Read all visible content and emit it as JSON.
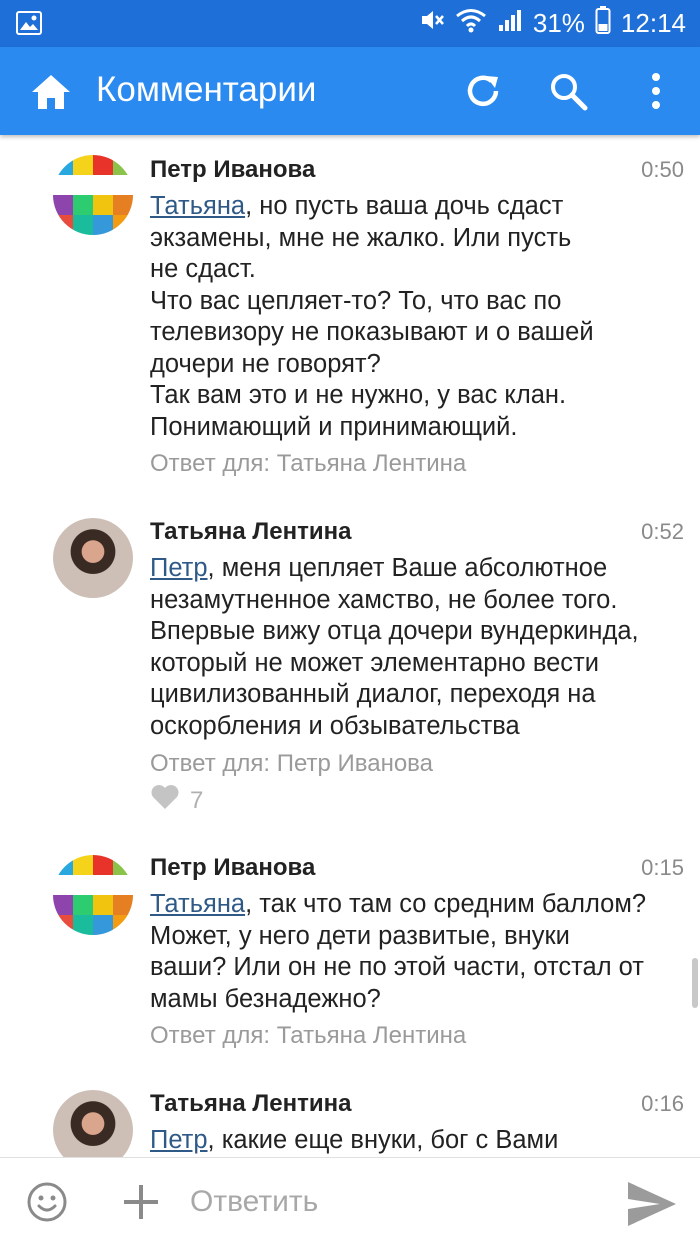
{
  "status_bar": {
    "battery": "31%",
    "time": "12:14"
  },
  "app_bar": {
    "title": "Комментарии"
  },
  "comments": [
    {
      "author": "Петр Иванова",
      "time": "0:50",
      "mention": "Татьяна",
      "text": ", но пусть ваша дочь сдаст\nэкзамены, мне не жалко. Или пусть\nне сдаст.\nЧто вас цепляет-то? То, что вас по\nтелевизору не показывают и о вашей\nдочери не говорят?\nТак вам это и не нужно, у вас клан.\nПонимающий и принимающий.",
      "reply_to": "Ответ для: Татьяна Лентина"
    },
    {
      "author": "Татьяна Лентина",
      "time": "0:52",
      "mention": "Петр",
      "text": ", меня цепляет Ваше абсолютное\nнезамутненное хамство, не более того.\nВпервые вижу отца дочери вундеркинда,\nкоторый не может элементарно вести\nцивилизованный диалог, переходя на\nоскорбления и обзывательства",
      "reply_to": "Ответ для: Петр Иванова",
      "likes": "7"
    },
    {
      "author": "Петр Иванова",
      "time": "0:15",
      "mention": "Татьяна",
      "text": ", так что там со средним баллом?\nМожет, у него дети развитые, внуки\nваши? Или он не по этой части, отстал от\nмамы безнадежно?",
      "reply_to": "Ответ для: Татьяна Лентина"
    },
    {
      "author": "Татьяна Лентина",
      "time": "0:16",
      "mention": "Петр",
      "text": ", какие еще внуки, бог с Вами"
    }
  ],
  "reply_bar": {
    "placeholder": "Ответить"
  },
  "colors": {
    "status_bar": "#1f6fd8",
    "app_bar": "#2b8af0",
    "mention": "#2f5a87",
    "meta_text": "#9a9a9a"
  },
  "icons": [
    "gallery-icon",
    "mute-icon",
    "wifi-icon",
    "signal-icon",
    "battery-icon",
    "home-icon",
    "refresh-icon",
    "search-icon",
    "more-vert-icon",
    "heart-icon",
    "emoji-icon",
    "plus-icon",
    "send-icon"
  ]
}
